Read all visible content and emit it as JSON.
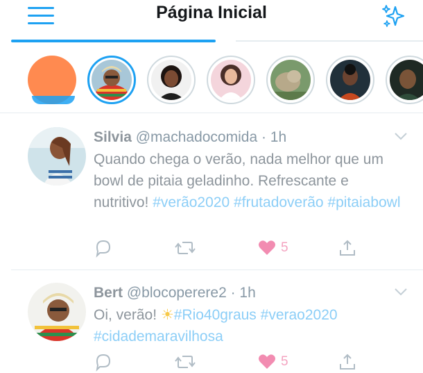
{
  "header": {
    "title": "Página Inicial",
    "menu_icon": "hamburger-menu-icon",
    "top_tweets_icon": "sparkle-icon",
    "accent_color": "#1da1f2"
  },
  "fleets": {
    "items": [
      {
        "name": "own-fleet",
        "color": "#ff8a50"
      },
      {
        "name": "fleet-1",
        "active": true
      },
      {
        "name": "fleet-2"
      },
      {
        "name": "fleet-3"
      },
      {
        "name": "fleet-4"
      },
      {
        "name": "fleet-5"
      },
      {
        "name": "fleet-6"
      }
    ]
  },
  "tweets": [
    {
      "name": "Silvia",
      "handle": "@machadocomida",
      "time": "· 1h",
      "text": "Quando chega o verão, nada melhor que um bowl de pitaia geladinho. Refrescante e nutritivo!",
      "hashtags": [
        "#verão2020",
        "#frutadoverão",
        "#pitaiabowl"
      ],
      "likes": "5"
    },
    {
      "name": "Bert",
      "handle": "@blocoperere2",
      "time": "· 1h",
      "text": "Oi, verão!",
      "hashtags": [
        "#Rio40graus",
        "#verao2020",
        "#cidademaravilhosa"
      ],
      "likes": "5"
    }
  ],
  "colors": {
    "like": "#e0245e",
    "hashtag": "#8ccef7",
    "muted_text": "#8d959c"
  }
}
